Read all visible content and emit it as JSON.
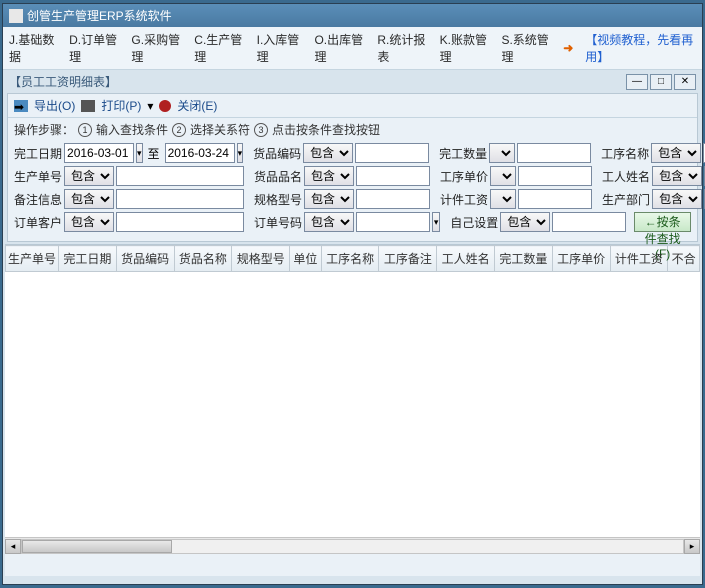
{
  "titlebar": {
    "title": "创管生产管理ERP系统软件"
  },
  "menubar": {
    "items": [
      "J.基础数据",
      "D.订单管理",
      "G.采购管理",
      "C.生产管理",
      "I.入库管理",
      "O.出库管理",
      "R.统计报表",
      "K.账款管理",
      "S.系统管理"
    ],
    "tutorial": "【视频教程，先看再用】"
  },
  "subwin": {
    "title": "【员工工资明细表】",
    "min": "—",
    "max": "□",
    "close": "✕"
  },
  "toolbar": {
    "export": "导出(O)",
    "print": "打印(P)",
    "close": "关闭(E)",
    "sep": "▾"
  },
  "steps": {
    "label": "操作步骤：",
    "s1": "输入查找条件",
    "s2": "选择关系符",
    "s3": "点击按条件查找按钮"
  },
  "filters": {
    "date_label": "完工日期",
    "date_from": "2016-03-01",
    "date_to_lbl": "至",
    "date_to": "2016-03-24",
    "code_label": "货品编码",
    "code_op": "包含",
    "qty_label": "完工数量",
    "proc_label": "工序名称",
    "proc_op": "包含",
    "prodno_label": "生产单号",
    "prodno_op": "包含",
    "name_label": "货品品名",
    "name_op": "包含",
    "price_label": "工序单价",
    "worker_label": "工人姓名",
    "worker_op": "包含",
    "remark_label": "备注信息",
    "remark_op": "包含",
    "spec_label": "规格型号",
    "spec_op": "包含",
    "wage_label": "计件工资",
    "dept_label": "生产部门",
    "dept_op": "包含",
    "cust_label": "订单客户",
    "cust_op": "包含",
    "orderno_label": "订单号码",
    "orderno_op": "包含",
    "self_label": "自己设置",
    "self_op": "包含",
    "search_btn": "←按条件查找(F)"
  },
  "table": {
    "cols": [
      "生产单号",
      "完工日期",
      "货品编码",
      "货品名称",
      "规格型号",
      "单位",
      "工序名称",
      "工序备注",
      "工人姓名",
      "完工数量",
      "工序单价",
      "计件工资",
      "不合"
    ]
  }
}
